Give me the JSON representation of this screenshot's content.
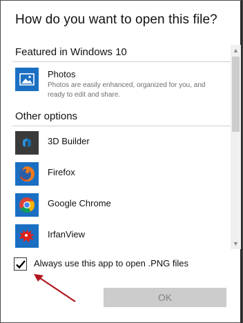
{
  "dialog": {
    "title": "How do you want to open this file?"
  },
  "featured": {
    "heading": "Featured in Windows 10",
    "app": {
      "name": "Photos",
      "description": "Photos are easily enhanced, organized for you, and ready to edit and share.",
      "icon": "photos-icon"
    }
  },
  "other": {
    "heading": "Other options",
    "apps": [
      {
        "name": "3D Builder",
        "icon": "3d-builder-icon"
      },
      {
        "name": "Firefox",
        "icon": "firefox-icon"
      },
      {
        "name": "Google Chrome",
        "icon": "chrome-icon"
      },
      {
        "name": "IrfanView",
        "icon": "irfanview-icon"
      }
    ]
  },
  "always_use": {
    "label": "Always use this app to open .PNG files",
    "checked": true
  },
  "ok_button": {
    "label": "OK",
    "enabled": false
  },
  "colors": {
    "photos_blue": "#1b6fc2",
    "builder_dark": "#3a3a3a",
    "arrow_red": "#b0141c",
    "button_disabled": "#cccccc"
  }
}
